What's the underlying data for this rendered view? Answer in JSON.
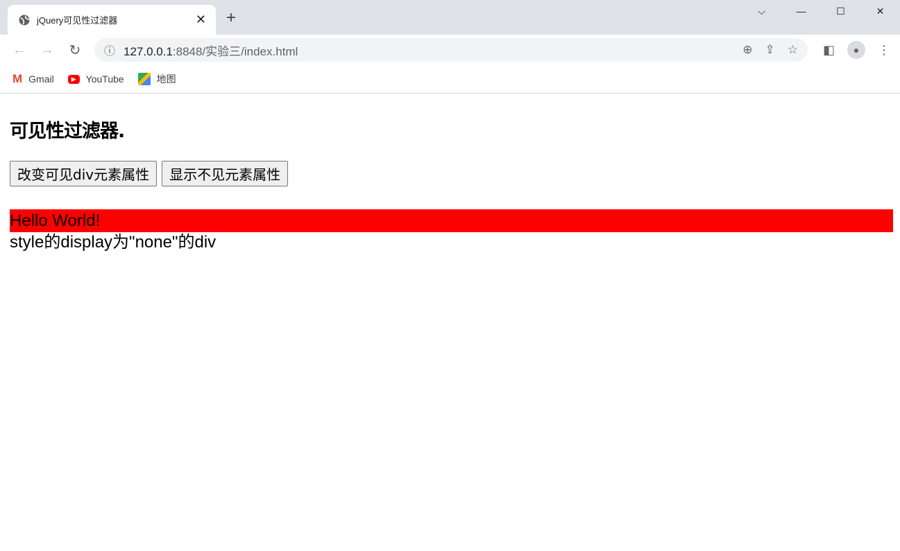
{
  "browser": {
    "tab_title": "jQuery可见性过滤器",
    "url_host": "127.0.0.1",
    "url_path": ":8848/实验三/index.html",
    "icons": [
      "globe-icon",
      "close-icon",
      "plus-icon",
      "back-icon",
      "forward-icon",
      "reload-icon",
      "info-icon",
      "zoom-icon",
      "share-icon",
      "star-icon",
      "sidepanel-icon",
      "profile-icon",
      "menu-icon"
    ],
    "bookmarks": [
      {
        "label": "Gmail",
        "icon": "gmail-icon"
      },
      {
        "label": "YouTube",
        "icon": "youtube-icon"
      },
      {
        "label": "地图",
        "icon": "maps-icon"
      }
    ]
  },
  "page": {
    "heading": "可见性过滤器.",
    "buttons": [
      "改变可见div元素属性",
      "显示不见元素属性"
    ],
    "visible_div": "Hello World!",
    "hidden_div": "style的display为\"none\"的div",
    "visible_div_color": "#ff0000"
  }
}
